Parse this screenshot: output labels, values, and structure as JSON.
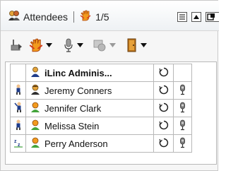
{
  "header": {
    "title": "Attendees",
    "count": "1/5",
    "icons": [
      "attendees-icon",
      "hand-raise-icon",
      "list-view-icon",
      "collapse-icon",
      "pin-icon"
    ]
  },
  "toolbar": {
    "items": [
      "pointer-tool-icon",
      "hand-raise-dropdown-icon",
      "microphone-dropdown-icon",
      "user-status-dropdown-icon",
      "exit-dropdown-icon"
    ]
  },
  "attendees": [
    {
      "name": "iLinc Adminis...",
      "bold": true,
      "role_icon": "",
      "avatar_icon": "presenter-icon",
      "has_mic": false
    },
    {
      "name": "Jeremy Conners",
      "bold": false,
      "role_icon": "standing-person-icon",
      "avatar_icon": "presenter-avatar-icon",
      "has_mic": true
    },
    {
      "name": "Jennifer Clark",
      "bold": false,
      "role_icon": "raised-hand-person-icon",
      "avatar_icon": "attendee-avatar-icon",
      "has_mic": true
    },
    {
      "name": "Melissa Stein",
      "bold": false,
      "role_icon": "standing-person-icon",
      "avatar_icon": "attendee-avatar-icon",
      "has_mic": true
    },
    {
      "name": "Perry Anderson",
      "bold": false,
      "role_icon": "sleeping-icon",
      "avatar_icon": "attendee-avatar-icon",
      "has_mic": true
    }
  ],
  "colors": {
    "accent_red": "#d43a1a",
    "accent_orange": "#f29a1e",
    "avatar_green": "#43a43b",
    "grid_border": "#b8b8b8"
  }
}
